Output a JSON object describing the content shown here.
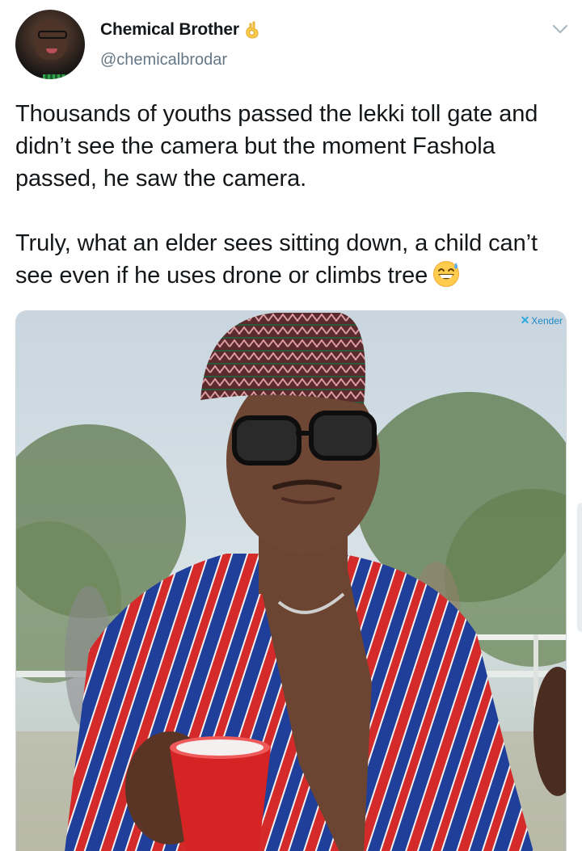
{
  "author": {
    "display_name": "Chemical Brother",
    "handle": "@chemicalbrodar",
    "name_emoji": "ok-hand-icon",
    "avatar": "avatar-photo"
  },
  "tweet": {
    "paragraph_1": "Thousands of youths passed the lekki toll gate and didn’t see the camera but the moment Fashola passed, he saw the camera.",
    "paragraph_2": "Truly, what an elder sees sitting down, a child can’t see even if he uses drone or climbs tree",
    "trailing_emoji": "grinning-sweat-icon"
  },
  "media": {
    "watermark": "Xender",
    "description_icon": "photo"
  },
  "colors": {
    "text": "#14171a",
    "secondary": "#657786",
    "border": "#ccd6dd",
    "emoji_yellow": "#ffcc4d",
    "watermark_blue": "#1e88c8"
  }
}
